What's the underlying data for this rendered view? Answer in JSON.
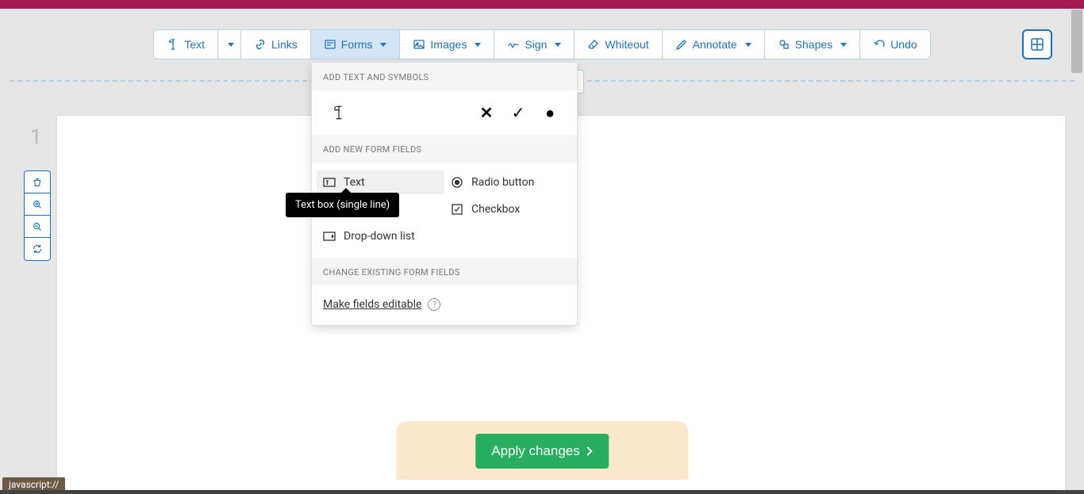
{
  "toolbar": {
    "text": "Text",
    "links": "Links",
    "forms": "Forms",
    "images": "Images",
    "sign": "Sign",
    "whiteout": "Whiteout",
    "annotate": "Annotate",
    "shapes": "Shapes",
    "undo": "Undo"
  },
  "dropdown": {
    "section1": "ADD TEXT AND SYMBOLS",
    "section2": "ADD NEW FORM FIELDS",
    "section3": "CHANGE EXISTING FORM FIELDS",
    "fields": {
      "text": "Text",
      "radio": "Radio button",
      "checkbox": "Checkbox",
      "dropdown": "Drop-down list"
    },
    "link": "Make fields editable"
  },
  "tooltip": "Text box (single line)",
  "page_number": "1",
  "apply_button": "Apply changes",
  "status": "javascript://"
}
